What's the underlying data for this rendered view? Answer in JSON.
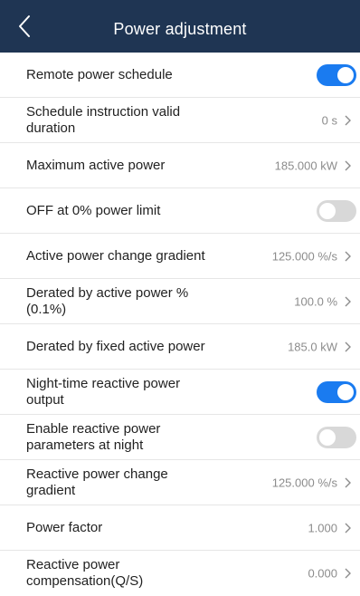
{
  "header": {
    "title": "Power adjustment",
    "back_icon": "chevron-left-icon",
    "background": "#1f3553"
  },
  "accent_color": "#1a7bf0",
  "toggle_off_color": "#d8d8d8",
  "rows": [
    {
      "label": "Remote power schedule",
      "type": "toggle",
      "on": true
    },
    {
      "label": "Schedule instruction valid duration",
      "type": "value",
      "value": "0 s"
    },
    {
      "label": "Maximum active power",
      "type": "value",
      "value": "185.000 kW"
    },
    {
      "label": "OFF at 0% power limit",
      "type": "toggle",
      "on": false
    },
    {
      "label": "Active power change gradient",
      "type": "value",
      "value": "125.000 %/s"
    },
    {
      "label": "Derated by active power % (0.1%)",
      "type": "value",
      "value": "100.0 %"
    },
    {
      "label": "Derated by fixed active power",
      "type": "value",
      "value": "185.0 kW"
    },
    {
      "label": "Night-time reactive power output",
      "type": "toggle",
      "on": true
    },
    {
      "label": "Enable reactive power parameters at night",
      "type": "toggle",
      "on": false
    },
    {
      "label": "Reactive power change gradient",
      "type": "value",
      "value": "125.000 %/s"
    },
    {
      "label": "Power factor",
      "type": "value",
      "value": "1.000"
    },
    {
      "label": "Reactive power compensation(Q/S)",
      "type": "value",
      "value": "0.000"
    }
  ]
}
